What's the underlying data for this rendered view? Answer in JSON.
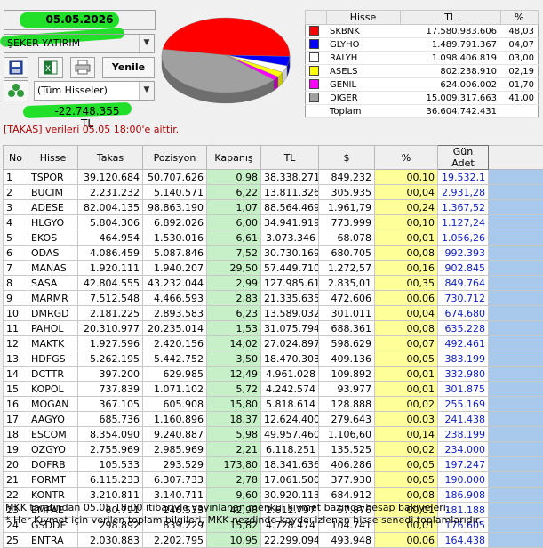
{
  "date": "05.05.2026",
  "account_select": {
    "value": "ŞEKER YATIRIM"
  },
  "toolbar": {
    "refresh_label": "Yenile",
    "icons": [
      "save-icon",
      "excel-icon",
      "printer-icon"
    ]
  },
  "filter_select": {
    "value": "(Tüm Hisseler)",
    "icon": "group-icon"
  },
  "total_value": "-22.748.355 TL",
  "takas_note": "[TAKAS] verileri 05.05 18:00'e aittir.",
  "legend": {
    "headers": [
      "",
      "Hisse",
      "TL",
      "%"
    ],
    "rows": [
      {
        "color": "#ff0000",
        "name": "SKBNK",
        "tl": "17.580.983.606",
        "pct": "48,03"
      },
      {
        "color": "#0000ff",
        "name": "GLYHO",
        "tl": "1.489.791.367",
        "pct": "04,07"
      },
      {
        "color": "#ffffff",
        "name": "RALYH",
        "tl": "1.098.406.819",
        "pct": "03,00"
      },
      {
        "color": "#ffff00",
        "name": "ASELS",
        "tl": "802.238.910",
        "pct": "02,19"
      },
      {
        "color": "#ff00ff",
        "name": "GENIL",
        "tl": "624.006.002",
        "pct": "01,70"
      },
      {
        "color": "#a0a0a0",
        "name": "DIGER",
        "tl": "15.009.317.663",
        "pct": "41,00"
      },
      {
        "color": "",
        "name": "Toplam",
        "tl": "36.604.742.431",
        "pct": ""
      }
    ]
  },
  "pie": {
    "slices": [
      {
        "name": "SKBNK",
        "value": 48.03,
        "color": "#ff0000"
      },
      {
        "name": "GLYHO",
        "value": 4.07,
        "color": "#0000ff"
      },
      {
        "name": "RALYH",
        "value": 3.0,
        "color": "#ffffff"
      },
      {
        "name": "ASELS",
        "value": 2.19,
        "color": "#ffff00"
      },
      {
        "name": "GENIL",
        "value": 1.7,
        "color": "#ff00ff"
      },
      {
        "name": "DIGER",
        "value": 41.0,
        "color": "#a0a0a0"
      }
    ]
  },
  "table": {
    "headers": [
      "No",
      "Hisse",
      "Takas",
      "Pozisyon",
      "Kapanış",
      "TL",
      "$",
      "%",
      "Gün Adet"
    ],
    "rows": [
      [
        "1",
        "TSPOR",
        "39.120.684",
        "50.707.626",
        "0,98",
        "38.338.271",
        "849.232",
        "00,10",
        "19.532,1"
      ],
      [
        "2",
        "BUCIM",
        "2.231.232",
        "5.140.571",
        "6,22",
        "13.811.326",
        "305.935",
        "00,04",
        "2.931,28"
      ],
      [
        "3",
        "ADESE",
        "82.004.135",
        "98.863.190",
        "1,07",
        "88.564.469",
        "1.961,79",
        "00,24",
        "1.367,52"
      ],
      [
        "4",
        "HLGYO",
        "5.804.306",
        "6.892.026",
        "6,00",
        "34.941.919",
        "773.999",
        "00,10",
        "1.127,24"
      ],
      [
        "5",
        "EKOS",
        "464.954",
        "1.530.016",
        "6,61",
        "3.073.346",
        "68.078",
        "00,01",
        "1.056,26"
      ],
      [
        "6",
        "ODAS",
        "4.086.459",
        "5.087.846",
        "7,52",
        "30.730.169",
        "680.705",
        "00,08",
        "992.393"
      ],
      [
        "7",
        "MANAS",
        "1.920.111",
        "1.940.207",
        "29,50",
        "57.449.710",
        "1.272,57",
        "00,16",
        "902.845"
      ],
      [
        "8",
        "SASA",
        "42.804.555",
        "43.232.044",
        "2,99",
        "127.985.61",
        "2.835,01",
        "00,35",
        "849.764"
      ],
      [
        "9",
        "MARMR",
        "7.512.548",
        "4.466.593",
        "2,83",
        "21.335.635",
        "472.606",
        "00,06",
        "730.712"
      ],
      [
        "10",
        "DMRGD",
        "2.181.225",
        "2.893.583",
        "6,23",
        "13.589.032",
        "301.011",
        "00,04",
        "674.680"
      ],
      [
        "11",
        "PAHOL",
        "20.310.977",
        "20.235.014",
        "1,53",
        "31.075.794",
        "688.361",
        "00,08",
        "635.228"
      ],
      [
        "12",
        "MAKTK",
        "1.927.596",
        "2.420.156",
        "14,02",
        "27.024.897",
        "598.629",
        "00,07",
        "492.461"
      ],
      [
        "13",
        "HDFGS",
        "5.262.195",
        "5.442.752",
        "3,50",
        "18.470.303",
        "409.136",
        "00,05",
        "383.199"
      ],
      [
        "14",
        "DCTTR",
        "397.200",
        "629.985",
        "12,49",
        "4.961.028",
        "109.892",
        "00,01",
        "332.980"
      ],
      [
        "15",
        "KOPOL",
        "737.839",
        "1.071.102",
        "5,72",
        "4.242.574",
        "93.977",
        "00,01",
        "301.875"
      ],
      [
        "16",
        "MOGAN",
        "367.105",
        "605.908",
        "15,80",
        "5.818.614",
        "128.888",
        "00,02",
        "255.169"
      ],
      [
        "17",
        "AAGYO",
        "685.736",
        "1.160.896",
        "18,37",
        "12.624.400",
        "279.643",
        "00,03",
        "241.438"
      ],
      [
        "18",
        "ESCOM",
        "8.354.090",
        "9.240.887",
        "5,98",
        "49.957.460",
        "1.106,60",
        "00,14",
        "238.199"
      ],
      [
        "19",
        "OZGYO",
        "2.755.969",
        "2.985.969",
        "2,21",
        "6.118.251",
        "135.525",
        "00,02",
        "234.000"
      ],
      [
        "20",
        "DOFRB",
        "105.533",
        "293.529",
        "173,80",
        "18.341.636",
        "406.286",
        "00,05",
        "197.247"
      ],
      [
        "21",
        "FORMT",
        "6.115.233",
        "6.307.733",
        "2,78",
        "17.061.500",
        "377.930",
        "00,05",
        "190.000"
      ],
      [
        "22",
        "KONTR",
        "3.210.811",
        "3.140.711",
        "9,60",
        "30.920.113",
        "684.912",
        "00,08",
        "186.908"
      ],
      [
        "23",
        "EMPAE",
        "60.791",
        "246.533",
        "42,98",
        "2.612.797",
        "57.876",
        "00,01",
        "181.188"
      ],
      [
        "24",
        "GSDDE",
        "298.892",
        "839.229",
        "15,82",
        "4.728.474",
        "104.741",
        "00,01",
        "176.605"
      ],
      [
        "25",
        "ENTRA",
        "2.030.883",
        "2.202.795",
        "10,95",
        "22.299.094",
        "493.948",
        "00,06",
        "164.438"
      ]
    ]
  },
  "footer": {
    "line1": "MKK tarafından 05.05 18:00 itibariyle yayınlanan menkul kıymet bazında hesap bakiyeleri.",
    "line2": "* Her Kıymet için verilen toplam bilgileri, MKK nezdinde kaydeı izlenen hisse senedi toplamlarıdır."
  },
  "colors": {
    "highlight": "#22e02a",
    "kapanis_bg": "#c8f0c8",
    "pct_bg": "#ffff99",
    "gun_adet_text": "#1020c0",
    "side_bg": "#a9c9ec",
    "takas_text": "#b00000"
  }
}
